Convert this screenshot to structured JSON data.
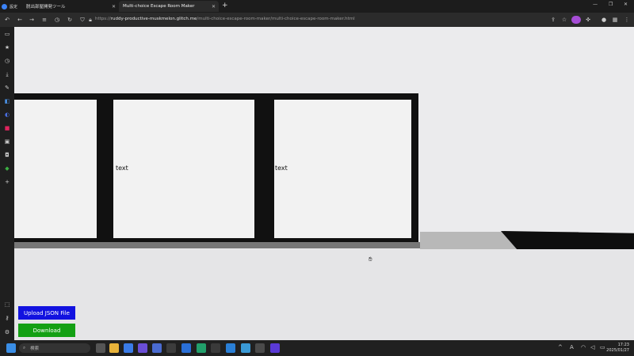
{
  "browser": {
    "pinned_tab_label": "設定",
    "tabs": [
      {
        "label": "脱出部屋開発ツール"
      },
      {
        "label": "Multi-choice Escape Room Maker"
      }
    ],
    "new_tab": "+",
    "url_prefix": "https://",
    "url_host": "ruddy-productive-muskmelon.glitch.me",
    "url_path": "/multi-choice-escape-room-maker/multi-choice-escape-room-maker.html",
    "window_controls": [
      "—",
      "❐",
      "✕"
    ]
  },
  "scene": {
    "panels": [
      {
        "text": ""
      },
      {
        "text": "text"
      },
      {
        "text": "text"
      }
    ]
  },
  "controls": {
    "upload_label": "Upload JSON File",
    "download_label": "Download",
    "upload_color": "#1212e0",
    "download_color": "#14a014"
  },
  "taskbar": {
    "search_placeholder": "検索",
    "time": "17:23",
    "date": "2025/01/27",
    "ime": "A"
  }
}
